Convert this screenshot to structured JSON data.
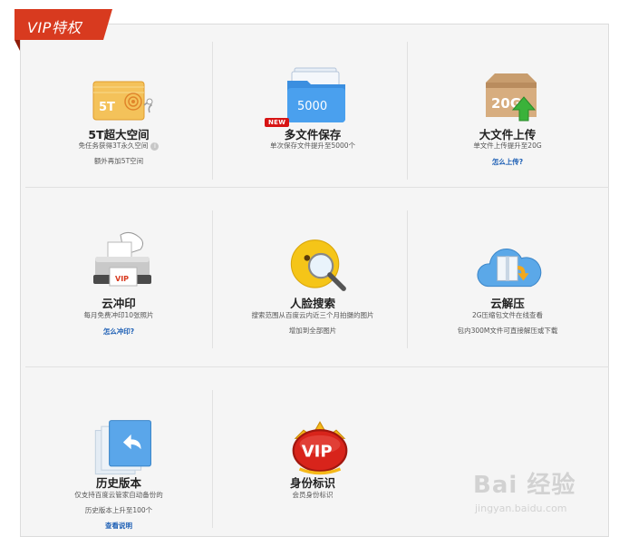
{
  "header": {
    "title": "VIP特权"
  },
  "features": [
    {
      "title": "5T超大空间",
      "desc": [
        "免任务获得3T永久空间",
        "额外再加5T空间"
      ],
      "link": "",
      "icon": "storage-card-icon",
      "icon_text": "5T"
    },
    {
      "title": "多文件保存",
      "desc": [
        "单次保存文件提升至5000个"
      ],
      "link": "",
      "badge": "NEW",
      "icon": "folder-icon",
      "icon_text": "5000"
    },
    {
      "title": "大文件上传",
      "desc": [
        "单文件上传提升至20G"
      ],
      "link": "怎么上传?",
      "icon": "upload-box-icon",
      "icon_text": "20G"
    },
    {
      "title": "云冲印",
      "desc": [
        "每月免费冲印10张照片"
      ],
      "link": "怎么冲印?",
      "icon": "printer-icon",
      "icon_text": "VIP"
    },
    {
      "title": "人脸搜索",
      "desc": [
        "搜索范围从百度云内近三个月拍摄的图片",
        "增加到全部图片"
      ],
      "link": "",
      "icon": "face-search-icon"
    },
    {
      "title": "云解压",
      "desc": [
        "2G压缩包文件在线查看",
        "包内300M文件可直接解压或下载"
      ],
      "link": "",
      "icon": "cloud-unzip-icon"
    },
    {
      "title": "历史版本",
      "desc": [
        "仅支持百度云管家自动备份的",
        "历史版本上升至100个"
      ],
      "link": "查看说明",
      "icon": "history-version-icon"
    },
    {
      "title": "身份标识",
      "desc": [
        "会员身份标识"
      ],
      "link": "",
      "icon": "vip-crown-icon",
      "icon_text": "VIP"
    }
  ],
  "watermark": {
    "main": "Bai 经验",
    "sub": "jingyan.baidu.com"
  },
  "colors": {
    "accent": "#d83a1f",
    "link": "#1d5fb5",
    "badge": "#d71414"
  }
}
